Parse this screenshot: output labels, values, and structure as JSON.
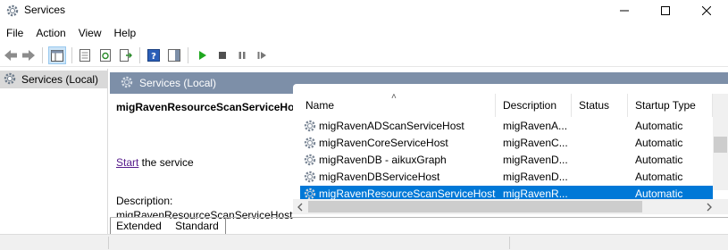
{
  "window": {
    "title": "Services"
  },
  "menu": [
    "File",
    "Action",
    "View",
    "Help"
  ],
  "tree": {
    "selected_label": "Services (Local)"
  },
  "pane": {
    "header_label": "Services (Local)",
    "service_name": "migRavenResourceScanServiceHost",
    "start_link": "Start",
    "start_suffix": " the service",
    "description_label": "Description:",
    "description_text": "migRavenResourceScanServiceHost"
  },
  "list": {
    "columns": [
      "Name",
      "Description",
      "Status",
      "Startup Type"
    ],
    "rows": [
      {
        "name": "migRavenADScanServiceHost",
        "description": "migRavenA...",
        "status": "",
        "startup": "Automatic",
        "selected": false
      },
      {
        "name": "migRavenCoreServiceHost",
        "description": "migRavenC...",
        "status": "",
        "startup": "Automatic",
        "selected": false
      },
      {
        "name": "migRavenDB - aikuxGraph",
        "description": "migRavenD...",
        "status": "",
        "startup": "Automatic",
        "selected": false
      },
      {
        "name": "migRavenDBServiceHost",
        "description": "migRavenD...",
        "status": "",
        "startup": "Automatic",
        "selected": false
      },
      {
        "name": "migRavenResourceScanServiceHost",
        "description": "migRavenR...",
        "status": "",
        "startup": "Automatic",
        "selected": true
      }
    ]
  },
  "tabs": [
    "Extended",
    "Standard"
  ],
  "colors": {
    "header_bg": "#7d8fa8",
    "selection": "#0078d7",
    "link": "#551a8b"
  }
}
